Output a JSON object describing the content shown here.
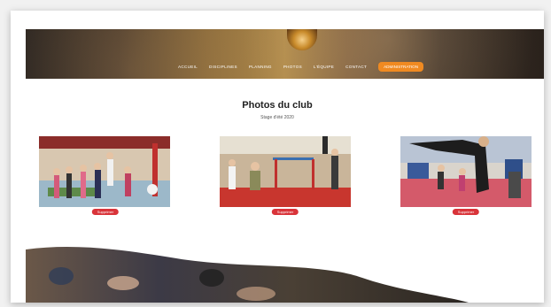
{
  "nav": {
    "items": [
      "ACCUEIL",
      "DISCIPLINES",
      "PLANNING",
      "PHOTOS",
      "L'ÉQUIPE",
      "CONTACT"
    ],
    "cta_label": "ADMINISTRATION"
  },
  "page": {
    "title": "Photos du club",
    "subtitle": "Stage d'été 2020"
  },
  "photos": [
    {
      "delete_label": "Supprimer"
    },
    {
      "delete_label": "Supprimer"
    },
    {
      "delete_label": "Supprimer"
    }
  ],
  "colors": {
    "accent": "#f08a21",
    "delete": "#d9343a"
  }
}
